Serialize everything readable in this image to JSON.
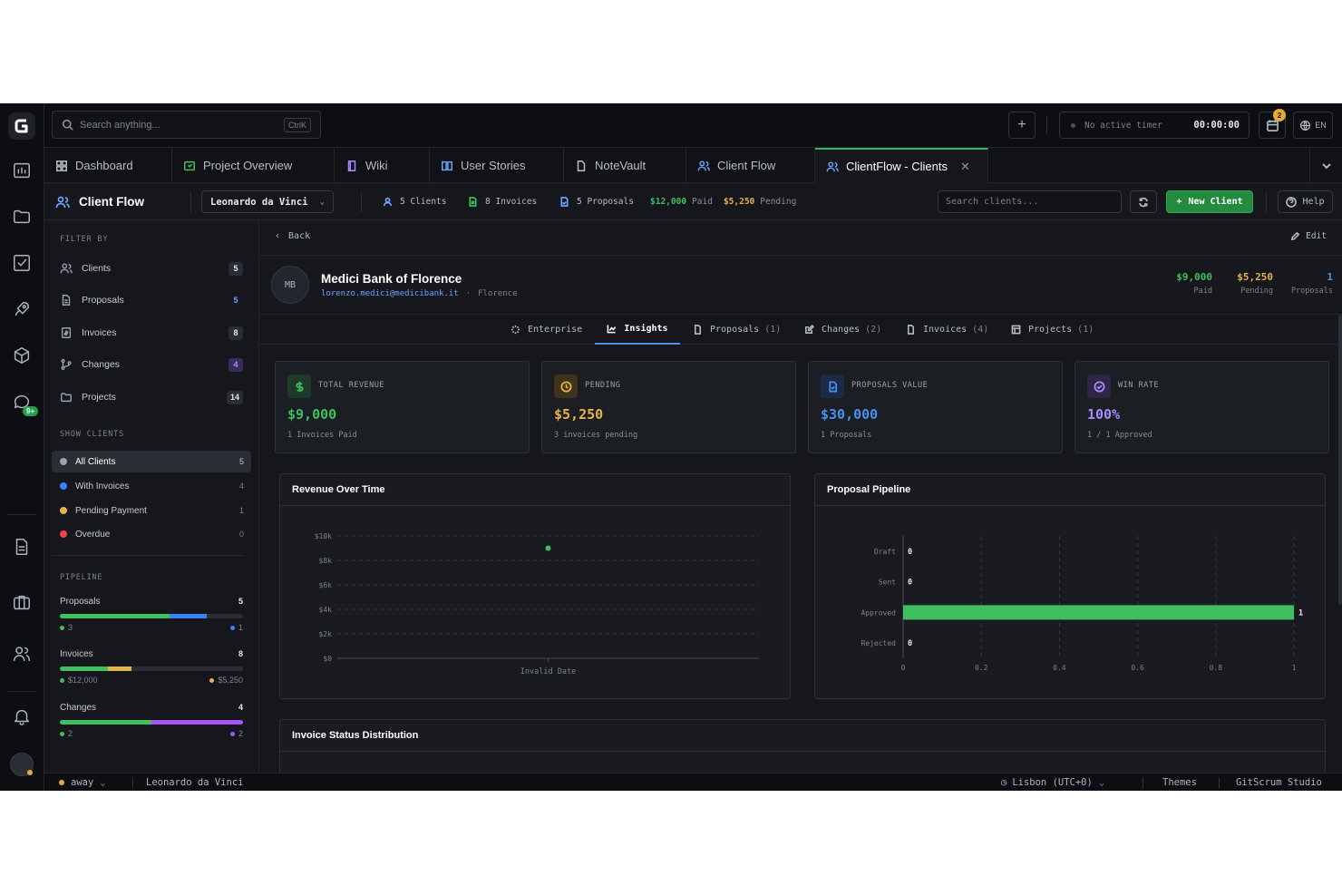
{
  "topbar": {
    "search_placeholder": "Search anything...",
    "search_shortcut": "CtrlK",
    "timer_label": "No active timer",
    "timer_value": "00:00:00",
    "calendar_badge": "2",
    "language": "EN"
  },
  "rail": {
    "messages_badge": "9+"
  },
  "tabs": [
    {
      "label": "Dashboard",
      "icon": "grid-icon"
    },
    {
      "label": "Project Overview",
      "icon": "project-icon"
    },
    {
      "label": "Wiki",
      "icon": "book-icon"
    },
    {
      "label": "User Stories",
      "icon": "open-book-icon"
    },
    {
      "label": "NoteVault",
      "icon": "file-icon"
    },
    {
      "label": "Client Flow",
      "icon": "users-icon"
    },
    {
      "label": "ClientFlow - Clients",
      "icon": "users-icon",
      "active": true
    }
  ],
  "module_header": {
    "title": "Client Flow",
    "user": "Leonardo da Vinci",
    "stats": {
      "clients": "5 Clients",
      "invoices": "8 Invoices",
      "proposals": "5 Proposals",
      "paid_amount": "$12,000",
      "paid_label": "Paid",
      "pending_amount": "$5,250",
      "pending_label": "Pending"
    },
    "search_placeholder": "Search clients...",
    "new_client_label": "New Client",
    "help_label": "Help"
  },
  "sidebar": {
    "filter_heading": "FILTER BY",
    "filters": [
      {
        "label": "Clients",
        "count": "5"
      },
      {
        "label": "Proposals",
        "count": "5"
      },
      {
        "label": "Invoices",
        "count": "8"
      },
      {
        "label": "Changes",
        "count": "4"
      },
      {
        "label": "Projects",
        "count": "14"
      }
    ],
    "show_heading": "SHOW CLIENTS",
    "show_options": [
      {
        "label": "All Clients",
        "count": "5",
        "color": "#9ca1ab",
        "selected": true
      },
      {
        "label": "With Invoices",
        "count": "4",
        "color": "#3b82f6"
      },
      {
        "label": "Pending Payment",
        "count": "1",
        "color": "#e6b24a"
      },
      {
        "label": "Overdue",
        "count": "0",
        "color": "#ef4444"
      }
    ],
    "pipeline_heading": "PIPELINE",
    "pipeline": [
      {
        "label": "Proposals",
        "total": "5",
        "left": "3",
        "right": "1",
        "left_color": "#3fbf5f",
        "right_color": "#3b82f6",
        "left_frac": 0.6,
        "right_frac": 0.2
      },
      {
        "label": "Invoices",
        "total": "8",
        "left": "$12,000",
        "right": "$5,250",
        "left_color": "#3fbf5f",
        "right_color": "#e6b24a",
        "left_frac": 0.26,
        "right_frac": 0.13
      },
      {
        "label": "Changes",
        "total": "4",
        "left": "2",
        "right": "2",
        "left_color": "#3fbf5f",
        "right_color": "#a855f7",
        "left_frac": 0.5,
        "right_frac": 0.5
      }
    ]
  },
  "client": {
    "back_label": "Back",
    "edit_label": "Edit",
    "initials": "MB",
    "name": "Medici Bank of Florence",
    "email": "lorenzo.medici@medicibank.it",
    "separator": "·",
    "city": "Florence",
    "paid_value": "$9,000",
    "paid_label": "Paid",
    "pending_value": "$5,250",
    "pending_label": "Pending",
    "proposals_value": "1",
    "proposals_label": "Proposals"
  },
  "subtabs": [
    {
      "label": "Enterprise",
      "count": ""
    },
    {
      "label": "Insights",
      "count": "",
      "active": true
    },
    {
      "label": "Proposals",
      "count": "(1)"
    },
    {
      "label": "Changes",
      "count": "(2)"
    },
    {
      "label": "Invoices",
      "count": "(4)"
    },
    {
      "label": "Projects",
      "count": "(1)"
    }
  ],
  "kpis": [
    {
      "label": "TOTAL REVENUE",
      "value": "$9,000",
      "sub": "1 Invoices Paid",
      "color": "#3fbf5f",
      "icon": "dollar-icon"
    },
    {
      "label": "PENDING",
      "value": "$5,250",
      "sub": "3 invoices pending",
      "color": "#e6b24a",
      "icon": "clock-icon"
    },
    {
      "label": "PROPOSALS VALUE",
      "value": "$30,000",
      "sub": "1 Proposals",
      "color": "#4a90f0",
      "icon": "document-icon"
    },
    {
      "label": "WIN RATE",
      "value": "100%",
      "sub": "1 / 1 Approved",
      "color": "#a98bff",
      "icon": "check-circle-icon"
    }
  ],
  "panels": {
    "revenue_title": "Revenue Over Time",
    "pipeline_title": "Proposal Pipeline",
    "invoice_title": "Invoice Status Distribution"
  },
  "chart_data": [
    {
      "type": "scatter",
      "title": "Revenue Over Time",
      "x": [
        "Invalid Date"
      ],
      "y": [
        9000
      ],
      "y_tick_labels": [
        "$10k",
        "$8k",
        "$6k",
        "$4k",
        "$2k",
        "$0"
      ],
      "ylim": [
        0,
        10000
      ],
      "grid": true,
      "color": "#3fbf5f"
    },
    {
      "type": "bar",
      "orientation": "horizontal",
      "title": "Proposal Pipeline",
      "categories": [
        "Draft",
        "Sent",
        "Approved",
        "Rejected"
      ],
      "values": [
        0,
        0,
        1,
        0
      ],
      "value_labels": [
        "0",
        "0",
        "1",
        "0"
      ],
      "x_ticks": [
        "0",
        "0.2",
        "0.4",
        "0.6",
        "0.8",
        "1"
      ],
      "xlim": [
        0,
        1
      ],
      "grid": true,
      "color": "#3fbf5f"
    }
  ],
  "status_bar": {
    "presence": "away",
    "user": "Leonardo da Vinci",
    "timezone": "Lisbon (UTC+0)",
    "themes": "Themes",
    "studio": "GitScrum Studio"
  }
}
